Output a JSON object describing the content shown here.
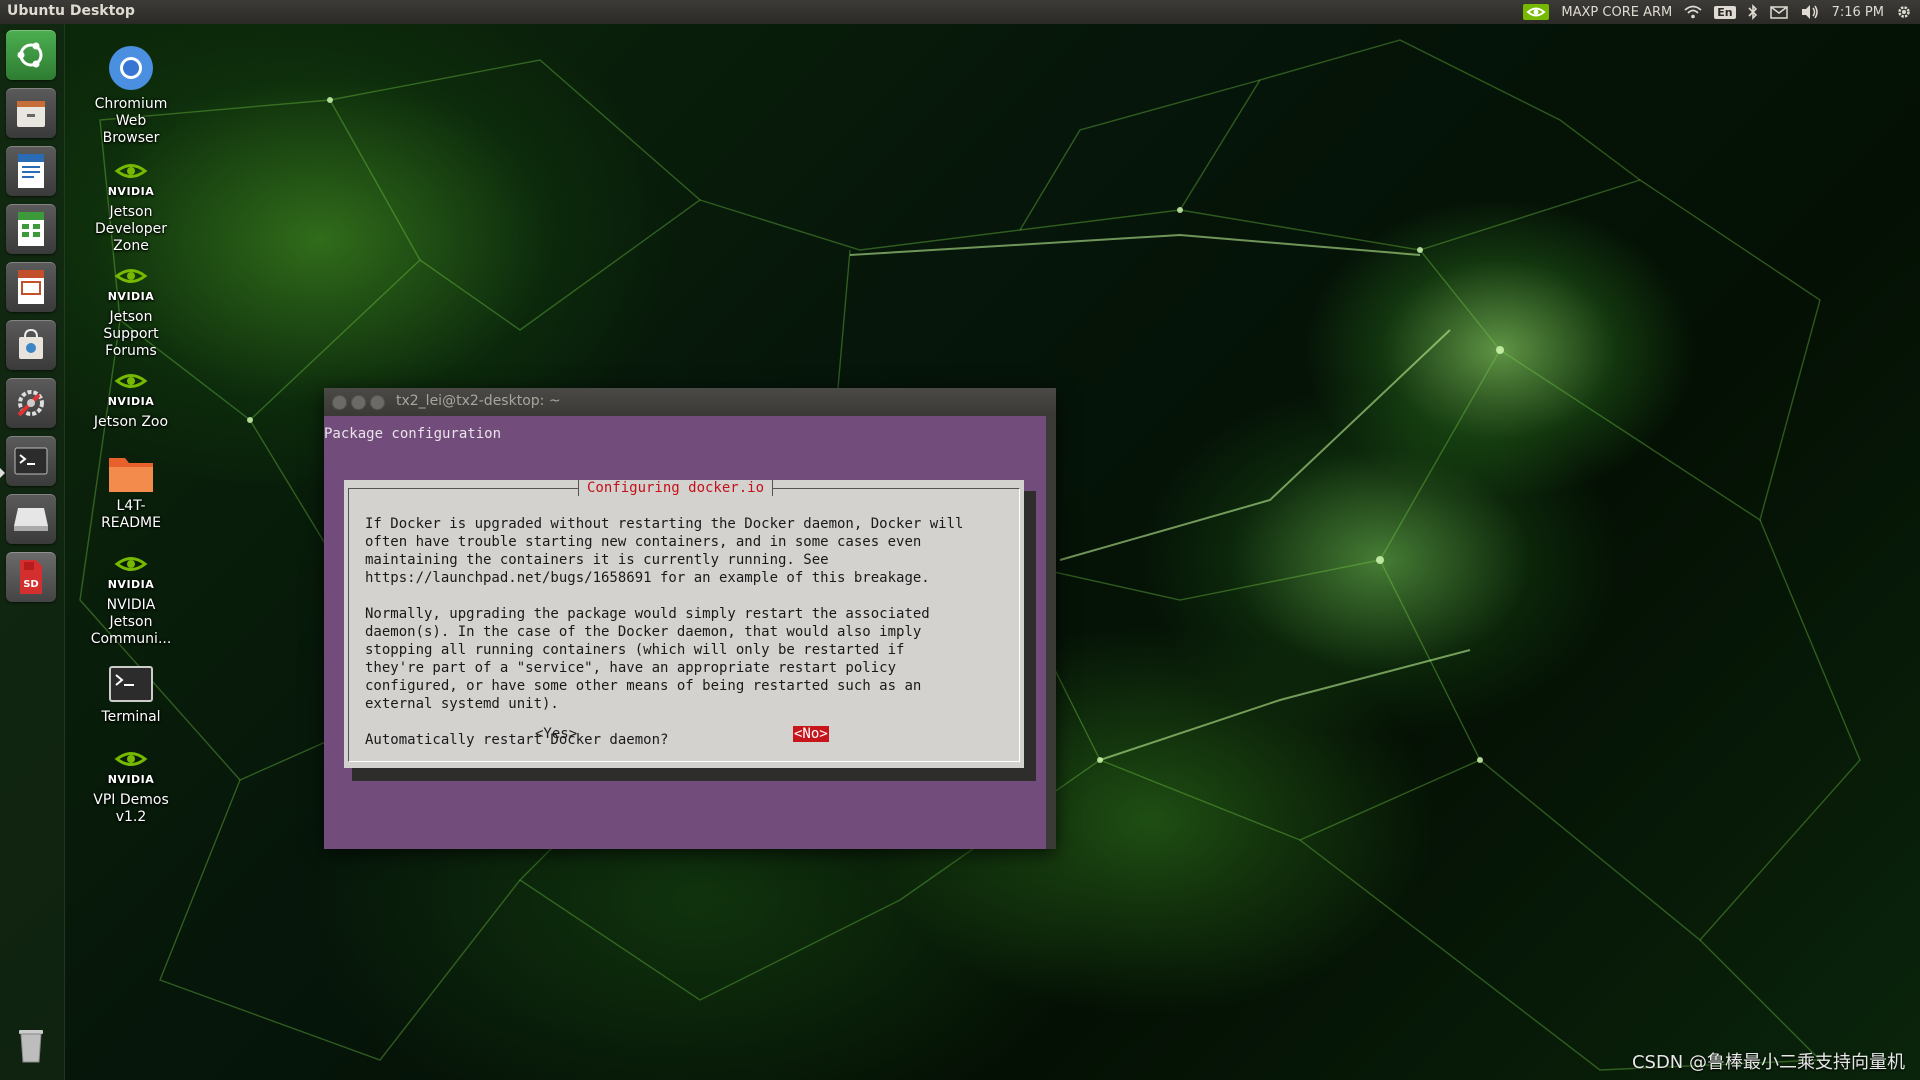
{
  "top_panel": {
    "title": "Ubuntu Desktop",
    "power_mode": "MAXP CORE ARM",
    "keyboard_layout": "En",
    "time": "7:16 PM"
  },
  "desktop_icons": [
    {
      "label": "Chromium\nWeb\nBrowser"
    },
    {
      "label": "Jetson\nDeveloper\nZone"
    },
    {
      "label": "Jetson\nSupport\nForums"
    },
    {
      "label": "Jetson Zoo"
    },
    {
      "label": "L4T-\nREADME"
    },
    {
      "label": "NVIDIA\nJetson\nCommuni..."
    },
    {
      "label": "Terminal"
    },
    {
      "label": "VPI Demos\nv1.2"
    }
  ],
  "nvidia_wordmark": "NVIDIA",
  "sd_label": "SD",
  "terminal": {
    "title": "tx2_lei@tx2-desktop: ~",
    "header": "Package configuration",
    "dialog_title": "Configuring docker.io",
    "body_text": "If Docker is upgraded without restarting the Docker daemon, Docker will\noften have trouble starting new containers, and in some cases even\nmaintaining the containers it is currently running. See\nhttps://launchpad.net/bugs/1658691 for an example of this breakage.\n\nNormally, upgrading the package would simply restart the associated\ndaemon(s). In the case of the Docker daemon, that would also imply\nstopping all running containers (which will only be restarted if\nthey're part of a \"service\", have an appropriate restart policy\nconfigured, or have some other means of being restarted such as an\nexternal systemd unit).\n\nAutomatically restart Docker daemon?",
    "yes_label": "<Yes>",
    "no_label": "<No>"
  },
  "watermark": "CSDN @鲁棒最小二乘支持向量机",
  "colors": {
    "dialog_title": "#c4101a",
    "selected_button": "#c7151c",
    "terminal_bg": "#724d7b",
    "nvidia_green": "#76b900"
  }
}
